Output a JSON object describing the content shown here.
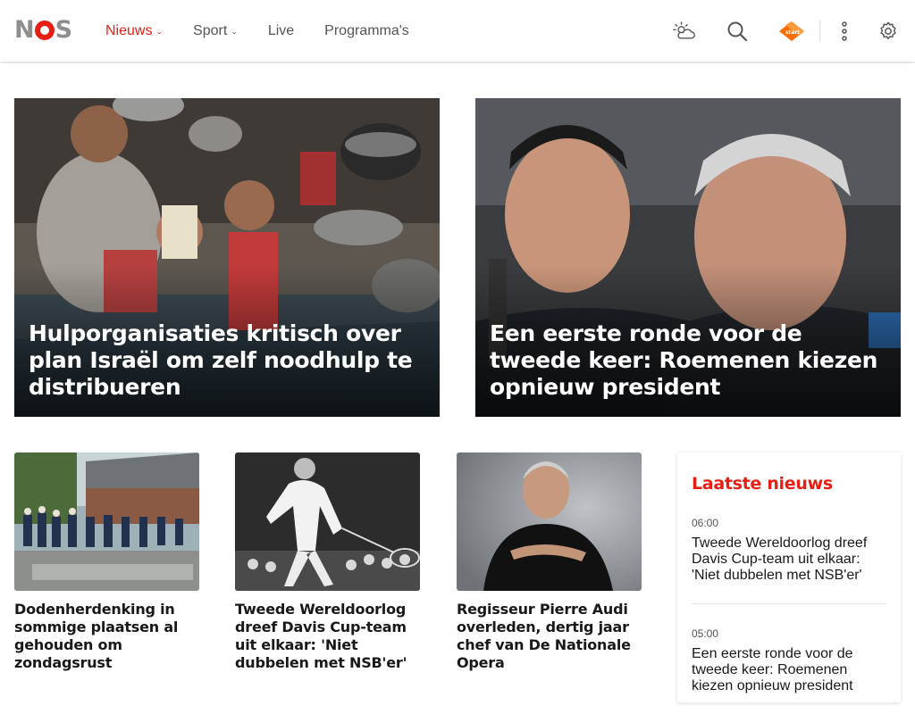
{
  "header": {
    "logo": {
      "n": "N",
      "s": "S"
    },
    "nav": [
      {
        "label": "Nieuws",
        "has_dropdown": true,
        "active": true
      },
      {
        "label": "Sport",
        "has_dropdown": true,
        "active": false
      },
      {
        "label": "Live",
        "has_dropdown": false,
        "active": false
      },
      {
        "label": "Programma's",
        "has_dropdown": false,
        "active": false
      }
    ],
    "icons": [
      "weather-icon",
      "search-icon",
      "npo-start-icon",
      "more-icon",
      "settings-icon"
    ],
    "npo_badge": "start"
  },
  "hero": [
    {
      "title": "Hulporganisaties kritisch over plan Israël om zelf noodhulp te distribueren"
    },
    {
      "title": "Een eerste ronde voor de tweede keer: Roemenen kiezen opnieuw president"
    }
  ],
  "cards": [
    {
      "title": "Dodenherdenking in sommige plaatsen al gehouden om zondagsrust"
    },
    {
      "title": "Tweede Wereldoorlog dreef Davis Cup-team uit elkaar: 'Niet dubbelen met NSB'er'"
    },
    {
      "title": "Regisseur Pierre Audi overleden, dertig jaar chef van De Nationale Opera"
    }
  ],
  "latest": {
    "heading": "Laatste nieuws",
    "items": [
      {
        "time": "06:00",
        "text": "Tweede Wereldoorlog dreef Davis Cup-team uit elkaar: 'Niet dubbelen met NSB'er'"
      },
      {
        "time": "05:00",
        "text": "Een eerste ronde voor de tweede keer: Roemenen kiezen opnieuw president"
      }
    ]
  },
  "colors": {
    "accent": "#e61e14",
    "text": "#191919",
    "muted": "#555555"
  }
}
